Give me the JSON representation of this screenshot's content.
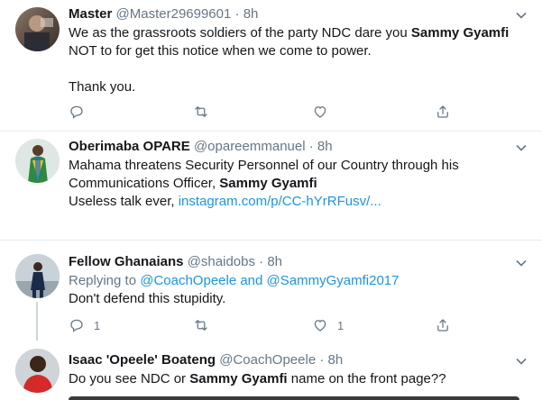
{
  "tweets": [
    {
      "name": "Master",
      "handle": "@Master29699601",
      "time": "8h",
      "lines": [
        {
          "a": "We as the grassroots soldiers of the party NDC dare you ",
          "b": "Sammy Gyamfi"
        },
        {
          "a": "NOT to for get this notice when we come to power."
        },
        {
          "a": "Thank you."
        }
      ],
      "reply_count": "",
      "like_count": ""
    },
    {
      "name": "Oberimaba OPARE",
      "handle": "@opareemmanuel",
      "time": "8h",
      "line1": "Mahama threatens Security Personnel of our Country through his",
      "line2": "Communications Officer, ",
      "line2b": "Sammy Gyamfi",
      "line3": "Useless talk ever, ",
      "link": "instagram.com/p/CC-hYrRFusv/..."
    },
    {
      "name": "Fellow Ghanaians",
      "handle": "@shaidobs",
      "time": "8h",
      "replying_prefix": "Replying to ",
      "replying_to": "@CoachOpeele and @SammyGyamfi2017",
      "text": "Don't defend this stupidity.",
      "reply_count": "1",
      "like_count": "1"
    },
    {
      "name": "Isaac 'Opeele' Boateng",
      "handle": "@CoachOpeele",
      "time": "8h",
      "text_a": "Do you see NDC or ",
      "text_b": "Sammy Gyamfi",
      "text_c": " name on the front page??"
    }
  ],
  "dot": "·",
  "colors": {
    "link": "#1b95e0",
    "meta": "#657786",
    "divider": "#e6ecf0"
  }
}
